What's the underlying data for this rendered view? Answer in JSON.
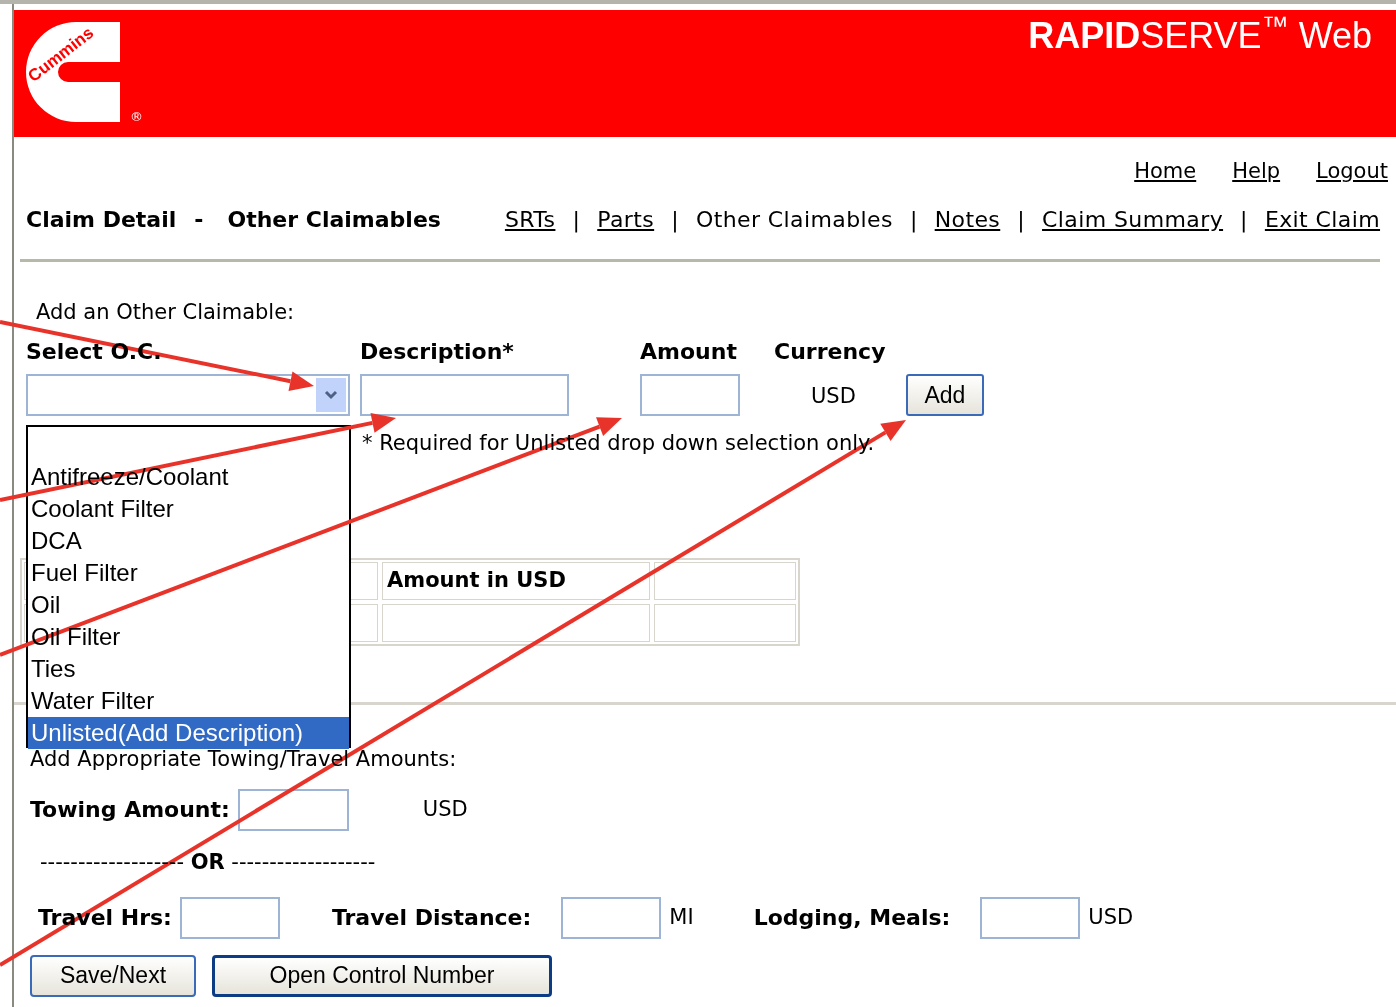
{
  "header": {
    "logo_text": "Cummins",
    "logo_mark": "®",
    "product": "**RAPID**SERVE$^{™}$ Web"
  },
  "top_links": [
    "Home",
    "Help",
    "Logout"
  ],
  "page_title": {
    "section": "Claim Detail",
    "separator": "-",
    "subsection": "Other Claimables"
  },
  "tabs": [
    {
      "label": "SRTs",
      "selected": false,
      "separator": "|"
    },
    {
      "label": "Parts",
      "selected": false,
      "separator": "|"
    },
    {
      "label": "Other Claimables",
      "selected": true,
      "separator": "|"
    },
    {
      "label": "Notes",
      "selected": false,
      "separator": "|"
    },
    {
      "label": "Claim Summary",
      "selected": false,
      "separator": "|"
    },
    {
      "label": "Exit Claim",
      "selected": false
    }
  ],
  "add_form": {
    "title": "Add an Other Claimable:",
    "columns": [
      "Select O.C.",
      "Description*",
      "Amount",
      "Currency"
    ],
    "currency": "USD",
    "add_button": "Add",
    "note": "* Required for Unlisted drop down selection only.",
    "dropdown": {
      "expanded": true,
      "options": [
        {
          "label": "Antifreeze/Coolant",
          "selected": false
        },
        {
          "label": "Coolant Filter",
          "selected": false
        },
        {
          "label": "DCA",
          "selected": false
        },
        {
          "label": "Fuel Filter",
          "selected": false
        },
        {
          "label": "Oil",
          "selected": false
        },
        {
          "label": "Oil Filter",
          "selected": false
        },
        {
          "label": "Ties",
          "selected": false
        },
        {
          "label": "Water Filter",
          "selected": false
        },
        {
          "label": "Unlisted(Add Description)",
          "selected": true
        }
      ]
    }
  },
  "claimables_table": {
    "visible_header": "Amount in USD"
  },
  "travel": {
    "title": "Add Appropriate Towing/Travel Amounts:",
    "towing_label": "Towing Amount:",
    "towing_unit": "USD",
    "or_line": "------------------- **OR** -------------------",
    "fields": [
      {
        "label": "Travel Hrs:"
      },
      {
        "label": "Travel Distance:",
        "unit": "MI"
      },
      {
        "label": "Lodging, Meals:",
        "unit": "USD"
      }
    ]
  },
  "buttons": [
    "Save/Next",
    "Open Control Number"
  ]
}
